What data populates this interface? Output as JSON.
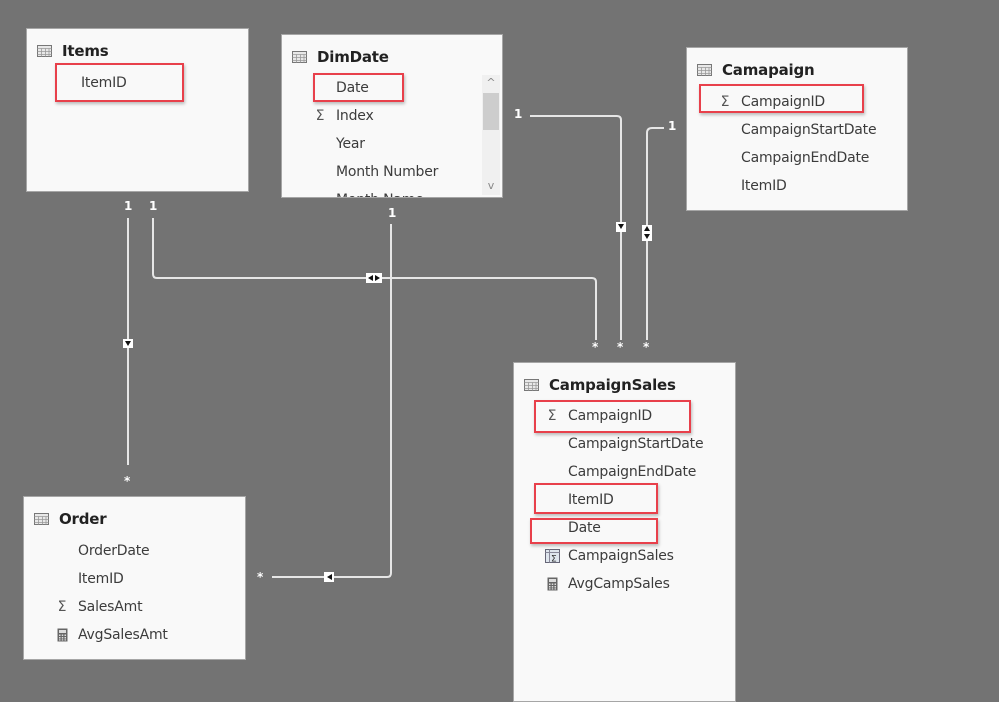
{
  "canvas": {
    "background": "#737373",
    "highlight_color": "#e8404b",
    "line_color": "#e6e6e6"
  },
  "tables": {
    "items": {
      "title": "Items",
      "fields": [
        {
          "label": "ItemID",
          "icon": "none",
          "highlighted": true
        }
      ]
    },
    "dimdate": {
      "title": "DimDate",
      "fields": [
        {
          "label": "Date",
          "icon": "none",
          "highlighted": true
        },
        {
          "label": "Index",
          "icon": "sigma-icon",
          "highlighted": false
        },
        {
          "label": "Year",
          "icon": "none",
          "highlighted": false
        },
        {
          "label": "Month Number",
          "icon": "none",
          "highlighted": false
        },
        {
          "label": "Month Name",
          "icon": "none",
          "highlighted": false
        }
      ],
      "scroll": {
        "up": "^",
        "down": "v"
      }
    },
    "campaign": {
      "title": "Camapaign",
      "fields": [
        {
          "label": "CampaignID",
          "icon": "sigma-icon",
          "highlighted": true
        },
        {
          "label": "CampaignStartDate",
          "icon": "none",
          "highlighted": false
        },
        {
          "label": "CampaignEndDate",
          "icon": "none",
          "highlighted": false
        },
        {
          "label": "ItemID",
          "icon": "none",
          "highlighted": false
        }
      ]
    },
    "campaignsales": {
      "title": "CampaignSales",
      "fields": [
        {
          "label": "CampaignID",
          "icon": "sigma-icon",
          "highlighted": true
        },
        {
          "label": "CampaignStartDate",
          "icon": "none",
          "highlighted": false
        },
        {
          "label": "CampaignEndDate",
          "icon": "none",
          "highlighted": false
        },
        {
          "label": "ItemID",
          "icon": "none",
          "highlighted": true
        },
        {
          "label": "Date",
          "icon": "none",
          "highlighted": true
        },
        {
          "label": "CampaignSales",
          "icon": "sigma-table-icon",
          "highlighted": false
        },
        {
          "label": "AvgCampSales",
          "icon": "calculator-icon",
          "highlighted": false
        }
      ]
    },
    "order": {
      "title": "Order",
      "fields": [
        {
          "label": "OrderDate",
          "icon": "none",
          "highlighted": false
        },
        {
          "label": "ItemID",
          "icon": "none",
          "highlighted": false
        },
        {
          "label": "SalesAmt",
          "icon": "sigma-icon",
          "highlighted": false
        },
        {
          "label": "AvgSalesAmt",
          "icon": "calculator-icon",
          "highlighted": false
        }
      ]
    }
  },
  "relationships": [
    {
      "from": "Items",
      "to": "Order",
      "one": "1",
      "many": "*",
      "filter": "single"
    },
    {
      "from": "Items",
      "to": "CampaignSales",
      "one": "1",
      "many": "*",
      "filter": "both"
    },
    {
      "from": "DimDate",
      "to": "Order",
      "one": "1",
      "many": "*",
      "filter": "single"
    },
    {
      "from": "DimDate",
      "to": "CampaignSales",
      "one": "1",
      "many": "*",
      "filter": "single"
    },
    {
      "from": "Camapaign",
      "to": "CampaignSales",
      "one": "1",
      "many": "*",
      "filter": "both"
    }
  ]
}
